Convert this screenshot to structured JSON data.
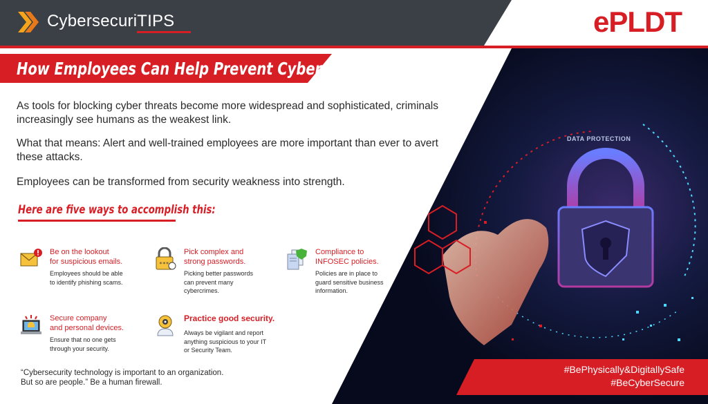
{
  "header": {
    "brand_title": "CybersecuriTIPS",
    "logo_text": "ePLDT",
    "brand_icon": "double-chevron-right-icon"
  },
  "heading": "How Employees Can Help Prevent Cyber Attacks",
  "paragraphs": [
    "As tools for blocking cyber threats become more widespread and sophisticated, criminals increasingly see humans as the weakest link.",
    "What that means: Alert and well-trained employees are more important than ever to avert these attacks.",
    "Employees can be transformed from security weakness into strength."
  ],
  "ways_title": "Here are five ways to accomplish this:",
  "tips": [
    {
      "icon": "envelope-alert-icon",
      "title": "Be on the lookout\nfor suspicious emails.",
      "desc": "Employees should be able\nto identify phishing scams."
    },
    {
      "icon": "padlock-icon",
      "title": "Pick complex and\nstrong passwords.",
      "desc": "Picking better passwords\ncan prevent many\ncybercrimes."
    },
    {
      "icon": "document-shield-icon",
      "title": "Compliance to\nINFOSEC policies.",
      "desc": "Policies are in place to\nguard sensitive business\ninformation."
    },
    {
      "icon": "laptop-alarm-icon",
      "title": "Secure company\nand personal devices.",
      "desc": "Ensure that no one gets\nthrough your security."
    },
    {
      "icon": "security-person-icon",
      "title": "Practice good security.",
      "desc": "Always be vigilant and report\nanything suspicious to your IT\nor Security Team."
    }
  ],
  "hero": {
    "label": "DATA PROTECTION"
  },
  "quote": "“Cybersecurity technology is important to an organization.\nBut so are people.”  Be a human firewall.",
  "hashtags": [
    "#BePhysically&DigitallySafe",
    "#BeCyberSecure"
  ],
  "colors": {
    "accent": "#d81e25",
    "dark": "#3b3f46",
    "hero_bg": "#0c1430"
  }
}
